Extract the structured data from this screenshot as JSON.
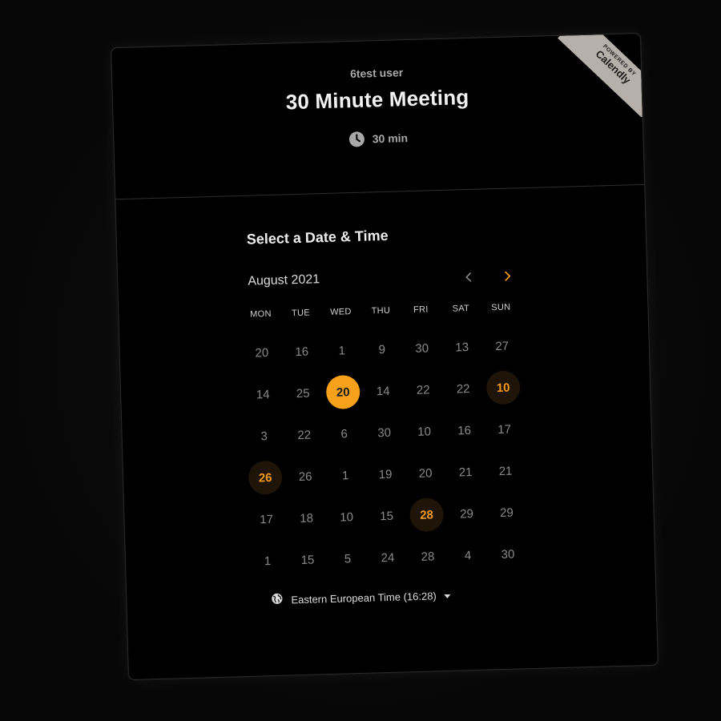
{
  "header": {
    "host": "6test user",
    "title": "30 Minute Meeting",
    "duration": "30 min"
  },
  "badge": {
    "small": "POWERED BY",
    "brand": "Calendly"
  },
  "calendar": {
    "heading": "Select a Date & Time",
    "month": "August 2021",
    "weekdays": [
      "MON",
      "TUE",
      "WED",
      "THU",
      "FRI",
      "SAT",
      "SUN"
    ],
    "days": [
      "20",
      "16",
      "1",
      "9",
      "30",
      "13",
      "27",
      "14",
      "25",
      "20",
      "14",
      "22",
      "22",
      "10",
      "3",
      "22",
      "6",
      "30",
      "10",
      "16",
      "17",
      "26",
      "26",
      "1",
      "19",
      "20",
      "21",
      "21",
      "17",
      "18",
      "10",
      "15",
      "28",
      "29",
      "29",
      "1",
      "15",
      "5",
      "24",
      "28",
      "4",
      "30"
    ],
    "selected_index": 9,
    "available_indices": [
      13,
      21,
      32
    ]
  },
  "timezone": {
    "label": "Eastern European Time (16:28)"
  },
  "colors": {
    "accent": "#f7a11a",
    "available_bg": "#1f1408",
    "available_text": "#f39a1c",
    "muted_text": "#8b8b8b"
  },
  "icons": {
    "duration": "clock-icon",
    "prev": "chevron-left-icon",
    "next": "chevron-right-icon",
    "timezone": "globe-icon",
    "timezone_dropdown": "caret-down-icon"
  }
}
